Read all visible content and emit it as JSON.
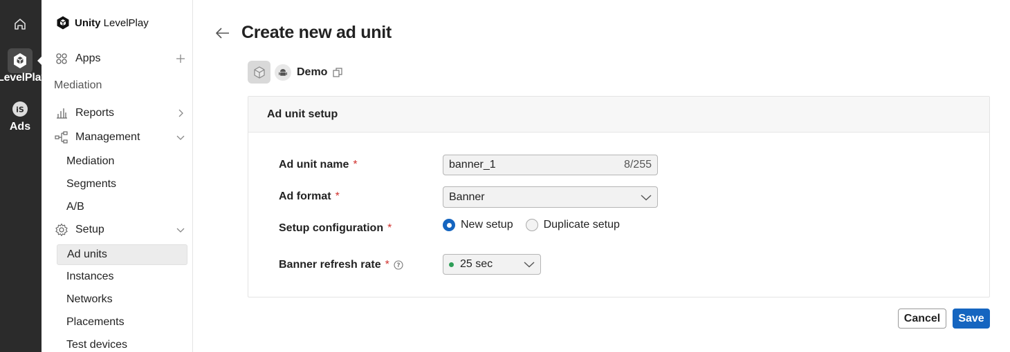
{
  "rail": {
    "items": [
      {
        "label": "",
        "icon": "home-icon"
      },
      {
        "label": "LevelPlay",
        "icon": "unity-logo-icon"
      },
      {
        "label": "Ads",
        "icon": "ironsource-icon"
      }
    ]
  },
  "sidebar": {
    "brand": {
      "bold": "Unity",
      "rest": "LevelPlay"
    },
    "apps_label": "Apps",
    "section_label": "Mediation",
    "reports_label": "Reports",
    "management_label": "Management",
    "management_items": [
      "Mediation",
      "Segments",
      "A/B"
    ],
    "setup_label": "Setup",
    "setup_items": [
      "Ad units",
      "Instances",
      "Networks",
      "Placements",
      "Test devices"
    ],
    "active_item": "Ad units"
  },
  "page": {
    "title": "Create new ad unit",
    "app_name": "Demo"
  },
  "card": {
    "title": "Ad unit setup",
    "fields": {
      "name": {
        "label": "Ad unit name",
        "value": "banner_1",
        "counter": "8/255"
      },
      "format": {
        "label": "Ad format",
        "value": "Banner"
      },
      "setup": {
        "label": "Setup configuration",
        "options": [
          "New setup",
          "Duplicate setup"
        ],
        "selected": "New setup"
      },
      "refresh": {
        "label": "Banner refresh rate",
        "value": "25 sec"
      }
    },
    "required_marker": "*"
  },
  "actions": {
    "cancel": "Cancel",
    "save": "Save"
  },
  "colors": {
    "primary": "#1565c0",
    "required": "#d0312d",
    "status_dot": "#2e9e57",
    "rail_bg": "#2b2b2b"
  }
}
